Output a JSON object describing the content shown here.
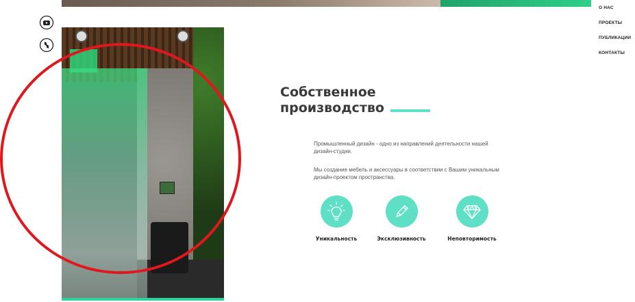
{
  "nav": {
    "items": [
      {
        "label": "О НАС"
      },
      {
        "label": "ПРОЕКТЫ"
      },
      {
        "label": "ПУБЛИКАЦИИ"
      },
      {
        "label": "КОНТАКТЫ"
      }
    ]
  },
  "social": {
    "icons": [
      "youtube-icon",
      "houzz-icon"
    ]
  },
  "main": {
    "title_line1": "Собственное",
    "title_line2": "производство",
    "paragraph1": "Промышленный дизайн - одно из направлений деятельности нашей дизайн-студии.",
    "paragraph2": "Мы создание мебель и аксессуары в соответствии с Вашим уникальным дизайн-проектом пространства."
  },
  "features": [
    {
      "label": "Уникальность",
      "icon": "lightbulb-icon"
    },
    {
      "label": "Эксклюзивность",
      "icon": "pencil-icon"
    },
    {
      "label": "Неповторимость",
      "icon": "diamond-icon"
    }
  ],
  "colors": {
    "accent": "#5fdfc6",
    "annotation_red": "#e0181e",
    "top_strip_green": "#2fcf8a"
  }
}
